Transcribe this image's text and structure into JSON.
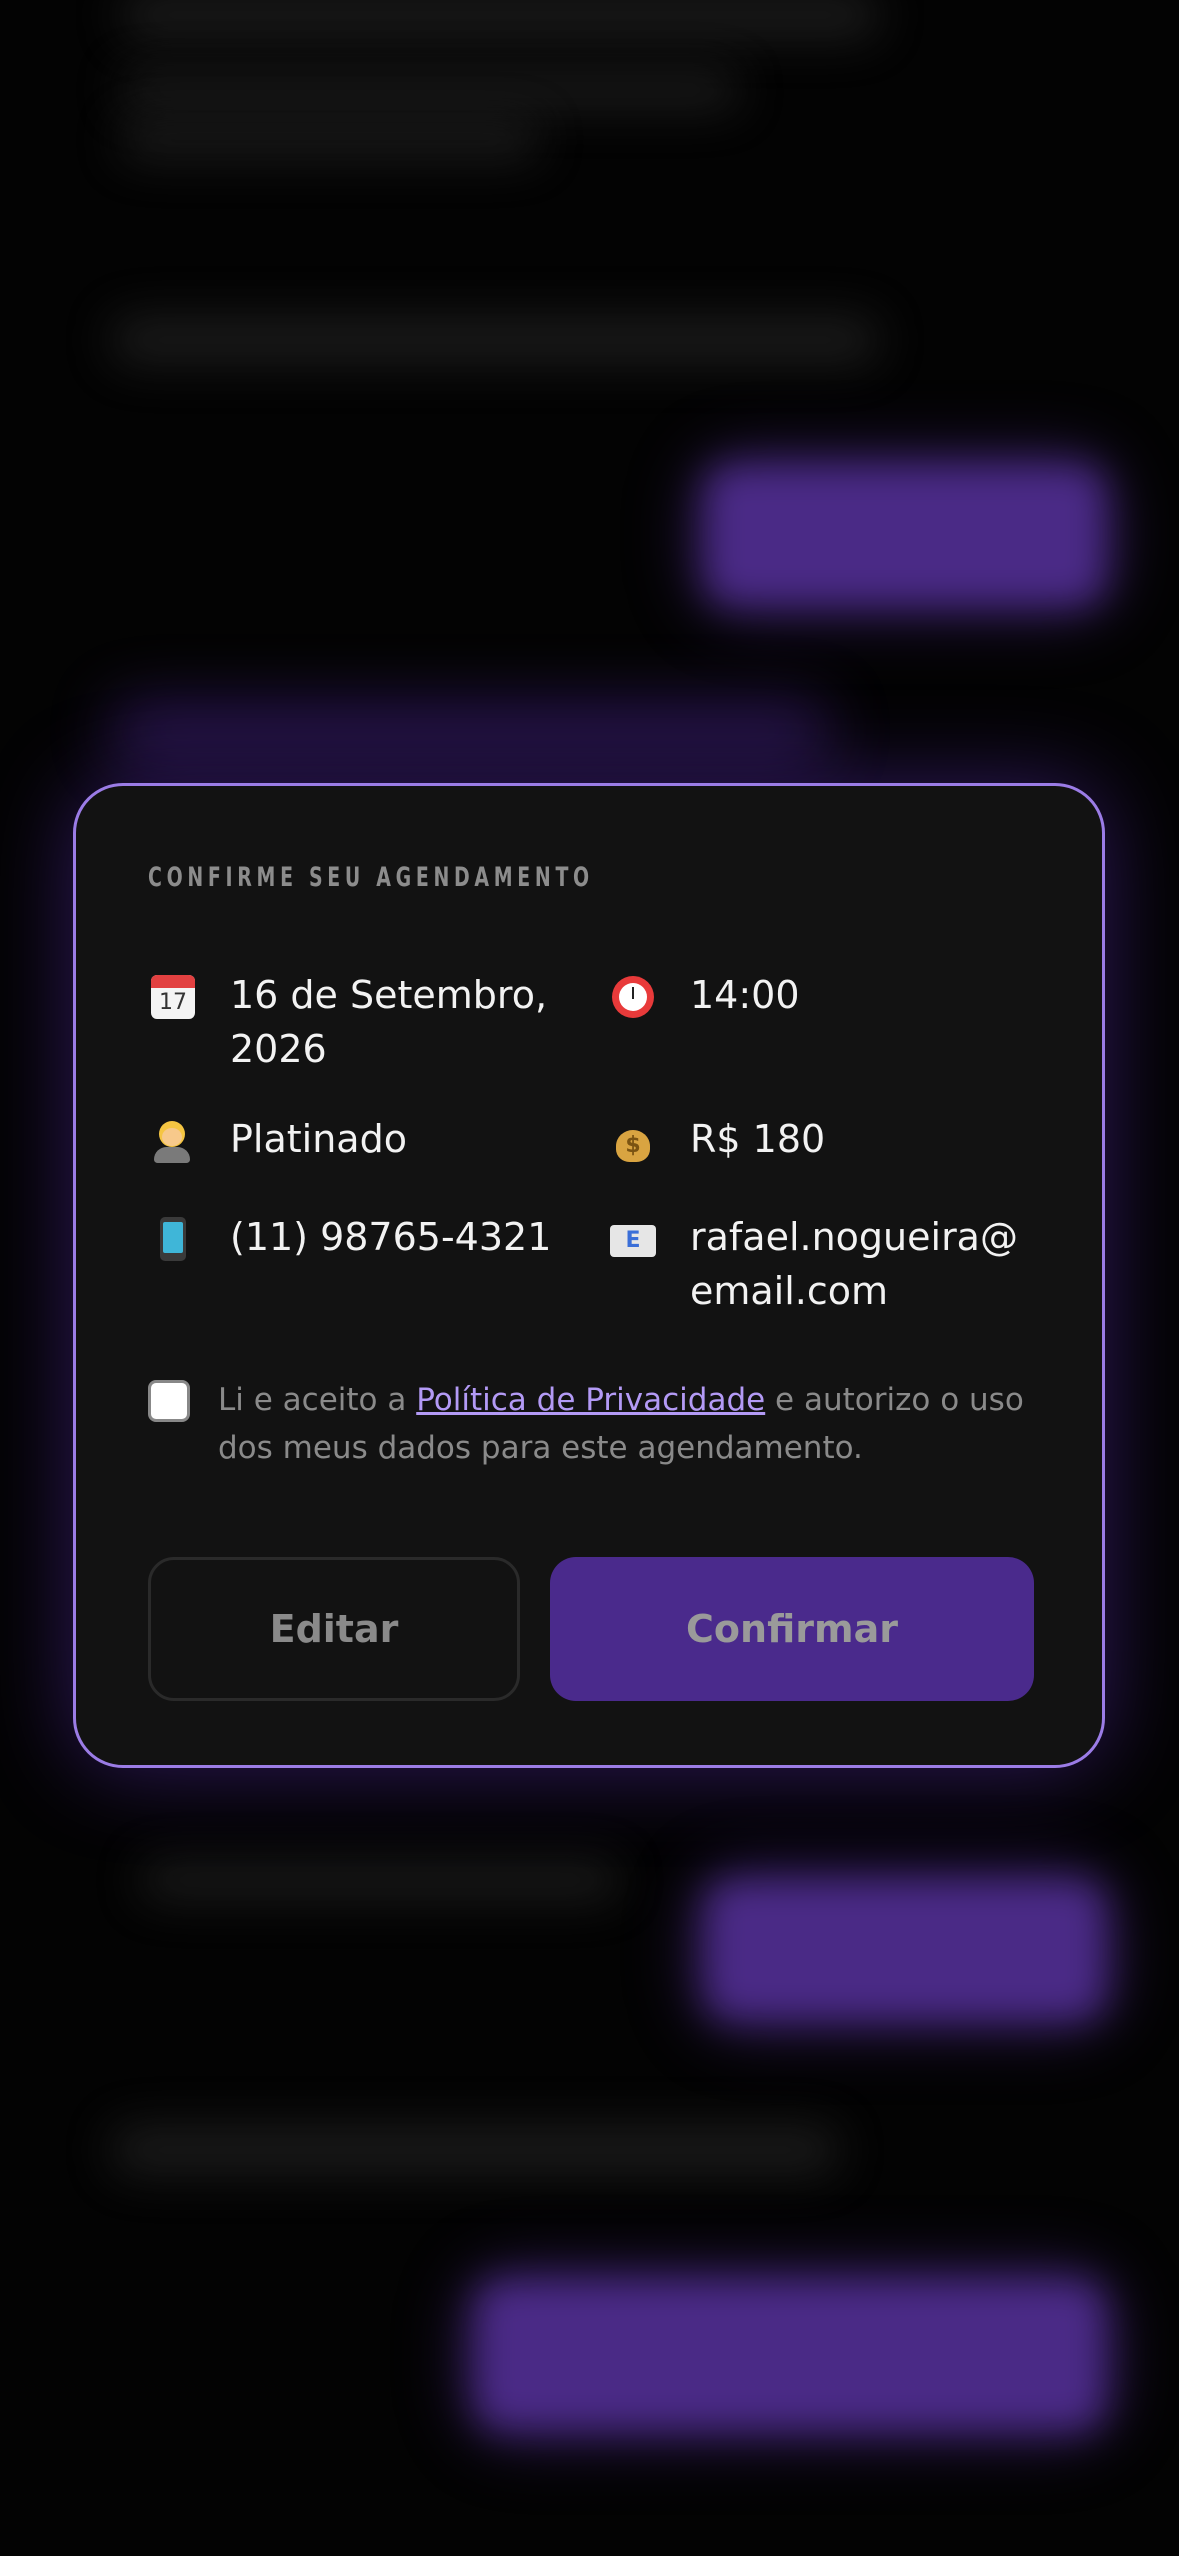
{
  "modal": {
    "title": "CONFIRME SEU AGENDAMENTO",
    "details": {
      "date": {
        "icon": "calendar-icon",
        "icon_text": "17",
        "value": "16 de Setembro, 2026"
      },
      "time": {
        "icon": "alarm-clock-icon",
        "value": "14:00"
      },
      "service": {
        "icon": "barber-person-icon",
        "value": "Platinado"
      },
      "price": {
        "icon": "money-bag-icon",
        "icon_text": "$",
        "value": "R$ 180"
      },
      "phone": {
        "icon": "mobile-phone-icon",
        "value": "(11) 98765-4321"
      },
      "email": {
        "icon": "email-icon",
        "icon_text": "E",
        "value": "rafael.nogueira@email.com"
      }
    },
    "consent": {
      "checked": false,
      "text_before": "Li e aceito a ",
      "link_text": "Política de Privacidade",
      "text_after": " e autorizo o uso dos meus dados para este agendamento."
    },
    "buttons": {
      "edit_label": "Editar",
      "confirm_label": "Confirmar"
    }
  },
  "colors": {
    "background": "#030303",
    "modal_background": "#121212",
    "modal_border": "#9b7ce6",
    "accent_purple": "#4a2a8c",
    "link": "#b39af5"
  }
}
